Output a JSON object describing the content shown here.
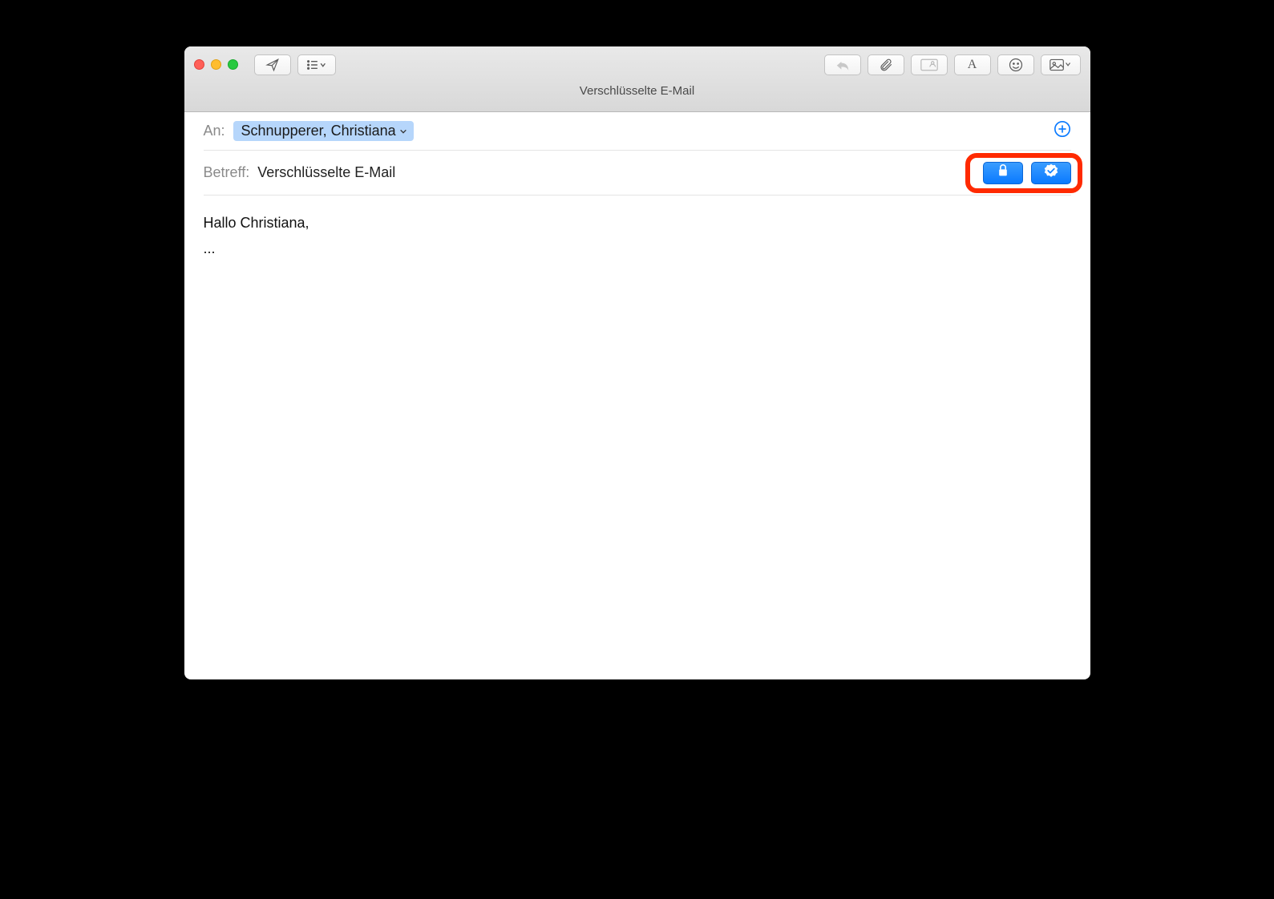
{
  "window_title": "Verschlüsselte E-Mail",
  "toolbar": {
    "send_icon": "paperplane-icon",
    "header_menu_icon": "list-chevron-icon",
    "reply_icon": "reply-icon",
    "attach_icon": "paperclip-icon",
    "markup_icon": "markup-attachment-icon",
    "format_icon": "font-a-icon",
    "emoji_icon": "smiley-icon",
    "photo_icon": "photo-chevron-icon"
  },
  "fields": {
    "to_label": "An:",
    "recipient_name": "Schnupperer, Christiana",
    "subject_label": "Betreff:",
    "subject_value": "Verschlüsselte E-Mail"
  },
  "security": {
    "encrypt_icon": "lock-icon",
    "sign_icon": "seal-check-icon"
  },
  "body": {
    "line1": "Hallo Christiana,",
    "line2": "..."
  }
}
